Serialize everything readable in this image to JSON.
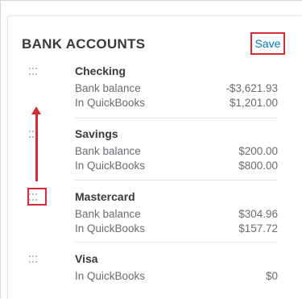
{
  "panel": {
    "title": "BANK ACCOUNTS",
    "save_label": "Save"
  },
  "accounts": [
    {
      "name": "Checking",
      "rows": [
        {
          "label": "Bank balance",
          "value": "-$3,621.93"
        },
        {
          "label": "In QuickBooks",
          "value": "$1,201.00"
        }
      ]
    },
    {
      "name": "Savings",
      "rows": [
        {
          "label": "Bank balance",
          "value": "$200.00"
        },
        {
          "label": "In QuickBooks",
          "value": "$800.00"
        }
      ]
    },
    {
      "name": "Mastercard",
      "rows": [
        {
          "label": "Bank balance",
          "value": "$304.96"
        },
        {
          "label": "In QuickBooks",
          "value": "$157.72"
        }
      ]
    },
    {
      "name": "Visa",
      "rows": [
        {
          "label": "In QuickBooks",
          "value": "$0"
        }
      ]
    }
  ],
  "colors": {
    "link": "#0077c5",
    "annotation_red": "#d52b35",
    "text_dark": "#393a3d",
    "text_muted": "#6b6c72"
  },
  "icons": {
    "drag_handle": "drag-handle-icon",
    "annotation_arrow": "arrow-up-icon"
  }
}
